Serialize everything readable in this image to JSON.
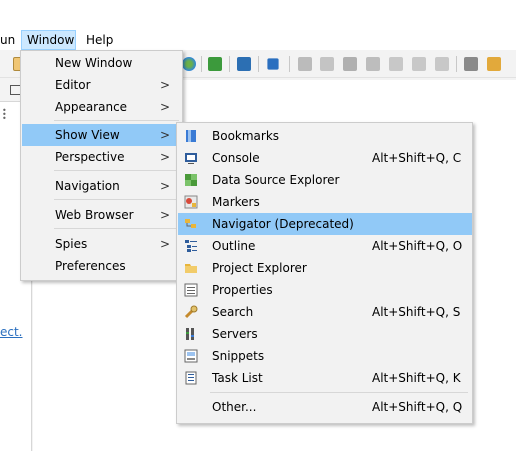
{
  "menubar": {
    "run_label": "un",
    "window_label": "Window",
    "help_label": "Help"
  },
  "window_menu": {
    "items": [
      {
        "label": "New Window"
      },
      {
        "label": "Editor"
      },
      {
        "label": "Appearance"
      },
      {
        "label": "Show View"
      },
      {
        "label": "Perspective"
      },
      {
        "label": "Navigation"
      },
      {
        "label": "Web Browser"
      },
      {
        "label": "Spies"
      },
      {
        "label": "Preferences"
      }
    ],
    "submenu_arrow": ">"
  },
  "show_view_menu": {
    "items": [
      {
        "label": "Bookmarks",
        "shortcut": "",
        "icon": "bookmarks-icon"
      },
      {
        "label": "Console",
        "shortcut": "Alt+Shift+Q, C",
        "icon": "console-icon"
      },
      {
        "label": "Data Source Explorer",
        "shortcut": "",
        "icon": "data-source-icon"
      },
      {
        "label": "Markers",
        "shortcut": "",
        "icon": "markers-icon"
      },
      {
        "label": "Navigator (Deprecated)",
        "shortcut": "",
        "icon": "navigator-icon"
      },
      {
        "label": "Outline",
        "shortcut": "Alt+Shift+Q, O",
        "icon": "outline-icon"
      },
      {
        "label": "Project Explorer",
        "shortcut": "",
        "icon": "project-explorer-icon"
      },
      {
        "label": "Properties",
        "shortcut": "",
        "icon": "properties-icon"
      },
      {
        "label": "Search",
        "shortcut": "Alt+Shift+Q, S",
        "icon": "search-icon"
      },
      {
        "label": "Servers",
        "shortcut": "",
        "icon": "servers-icon"
      },
      {
        "label": "Snippets",
        "shortcut": "",
        "icon": "snippets-icon"
      },
      {
        "label": "Task List",
        "shortcut": "Alt+Shift+Q, K",
        "icon": "task-list-icon"
      },
      {
        "label": "Other...",
        "shortcut": "Alt+Shift+Q, Q",
        "icon": ""
      }
    ]
  },
  "left_pane": {
    "link_text": "ect."
  },
  "colors": {
    "highlight": "#91c9f7",
    "menu_bg": "#f2f2f2",
    "menubar_active": "#cce8ff",
    "link": "#2a6fbf"
  }
}
